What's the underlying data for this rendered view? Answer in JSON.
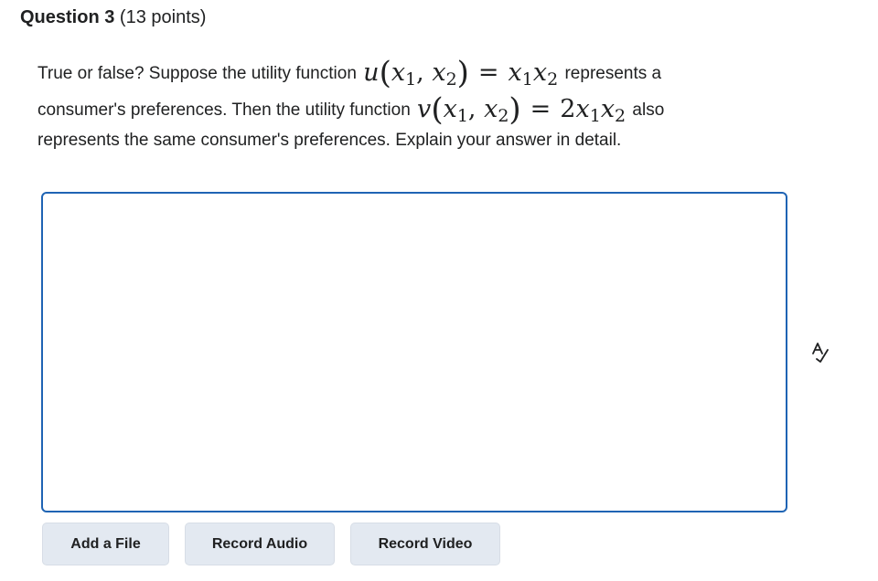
{
  "question": {
    "label": "Question 3",
    "points": " (13 points)"
  },
  "prompt": {
    "line1_before": "True or false? Suppose the utility function ",
    "line1_after": " represents a",
    "line2_before": "consumer's preferences. Then the utility function ",
    "line2_after": " also",
    "line3": "represents the same consumer's preferences. Explain your answer in detail."
  },
  "math": {
    "u_func": "u",
    "v_func": "v",
    "var": "x",
    "sub1": "1",
    "sub2": "2",
    "comma": ", ",
    "open": "(",
    "close": ")",
    "equals": "=",
    "coef": "2"
  },
  "answer": {
    "value": ""
  },
  "buttons": {
    "add_file": "Add a File",
    "record_audio": "Record Audio",
    "record_video": "Record Video"
  },
  "icons": {
    "spellcheck": "spellcheck-icon"
  },
  "colors": {
    "focus_border": "#1f64b4",
    "button_bg": "#e3e9f1",
    "text": "#202122"
  }
}
